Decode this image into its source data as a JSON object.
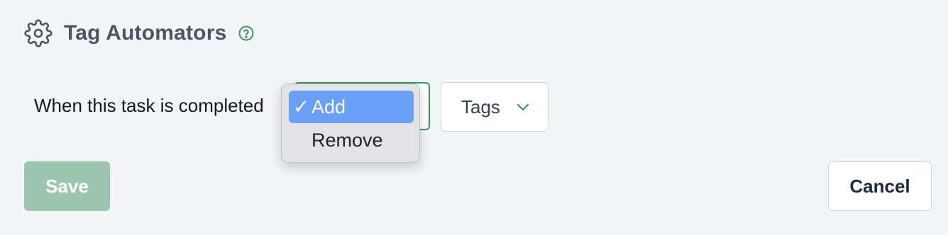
{
  "header": {
    "title": "Tag Automators",
    "icon": "gear-icon",
    "help_icon": "help-circle-icon"
  },
  "rule": {
    "prefix": "When this task is completed",
    "action_options": [
      {
        "label": "Add",
        "checked": true
      },
      {
        "label": "Remove",
        "checked": false
      }
    ],
    "checkmark": "✓",
    "tags_label": "Tags"
  },
  "actions": {
    "save_label": "Save",
    "cancel_label": "Cancel"
  },
  "colors": {
    "background": "#f3f4f6",
    "accent_green": "#3f8f63",
    "save_disabled": "#9cc6b1",
    "selected_option": "#699ff4",
    "popup_bg": "#e3e3e6"
  }
}
